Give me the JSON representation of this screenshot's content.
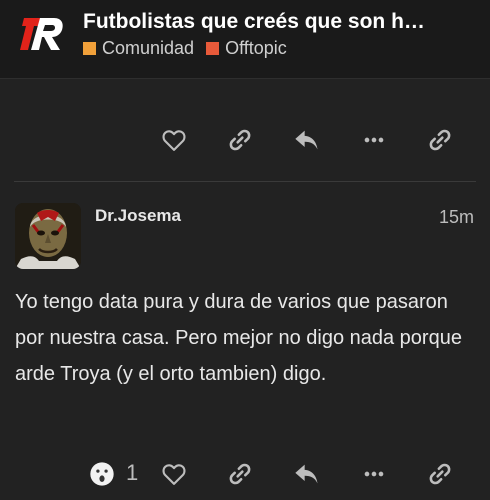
{
  "header": {
    "title": "Futbolistas que creés que son h…",
    "categories": [
      {
        "label": "Comunidad",
        "color": "#f0a03a"
      },
      {
        "label": "Offtopic",
        "color": "#e85a3a"
      }
    ]
  },
  "colors": {
    "icon": "#bdbdbd",
    "background": "#222222",
    "header_bg": "#1a1a1a"
  },
  "prev_post": {
    "actions": [
      "heart-icon",
      "link-icon",
      "reply-icon",
      "more-icon",
      "share-link-icon"
    ]
  },
  "post": {
    "username": "Dr.Josema",
    "time": "15m",
    "text": "Yo tengo data pura y dura de varios que pasaron por nuestra casa. Pero mejor no digo nada porque arde Troya (y el orto tambien) digo.",
    "reaction_icon": "surprised-face-icon",
    "reaction_count": "1",
    "actions": [
      "heart-icon",
      "link-icon",
      "reply-icon",
      "more-icon",
      "share-link-icon"
    ]
  }
}
